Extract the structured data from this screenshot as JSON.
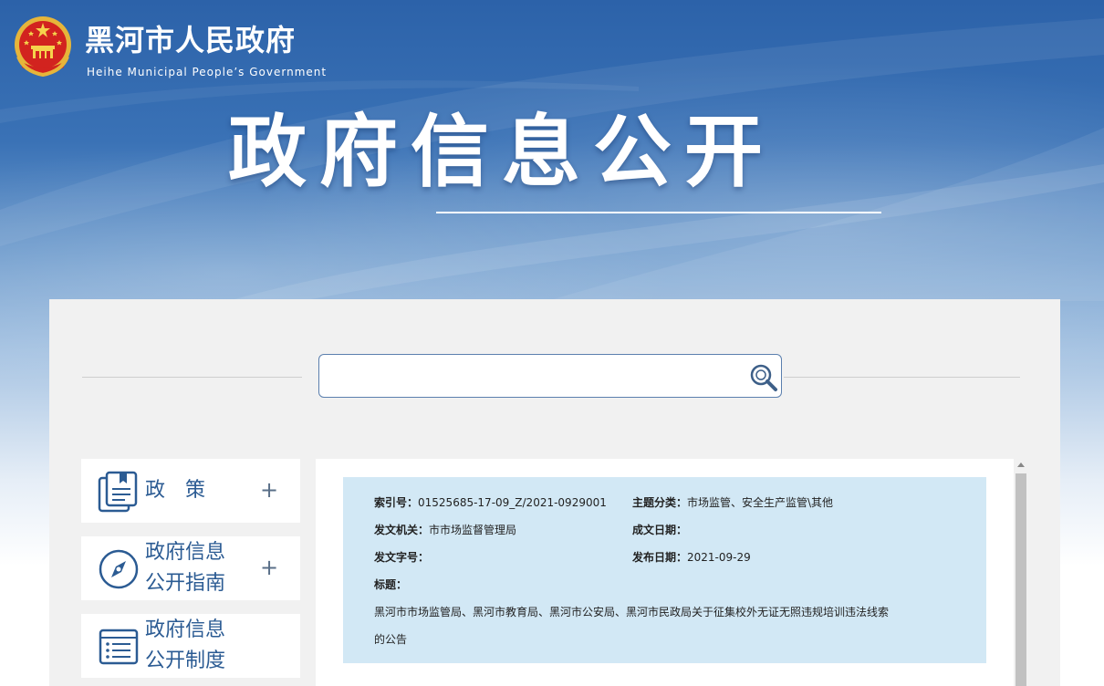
{
  "header": {
    "site_name": "黑河市人民政府",
    "site_name_en": "Heihe Municipal People’s Government",
    "hero_title": "政府信息公开"
  },
  "search": {
    "value": "",
    "placeholder": ""
  },
  "sidebar": {
    "items": [
      {
        "label_line1": "政　策",
        "label_line2": "",
        "icon": "document-icon",
        "expand": "+"
      },
      {
        "label_line1": "政府信息",
        "label_line2": "公开指南",
        "icon": "compass-icon",
        "expand": "+"
      },
      {
        "label_line1": "政府信息",
        "label_line2": "公开制度",
        "icon": "list-icon",
        "expand": ""
      }
    ]
  },
  "meta": {
    "index_no_label": "索引号：",
    "index_no": "01525685-17-09_Z/2021-0929001",
    "topic_label": "主题分类：",
    "topic": "市场监管、安全生产监管\\其他",
    "issuer_label": "发文机关：",
    "issuer": "市市场监督管理局",
    "created_label": "成文日期：",
    "created": "",
    "doc_no_label": "发文字号：",
    "doc_no": "",
    "publish_label": "发布日期：",
    "publish": "2021-09-29",
    "title_label": "标题：",
    "title_line1": "黑河市市场监管局、黑河市教育局、黑河市公安局、黑河市民政局关于征集校外无证无照违规培训违法线索",
    "title_line2": "的公告"
  },
  "colors": {
    "banner_blue": "#2c62a9",
    "nav_text": "#2b5b93",
    "meta_bg": "#d2e8f5",
    "panel_bg": "#f1f1f1"
  }
}
